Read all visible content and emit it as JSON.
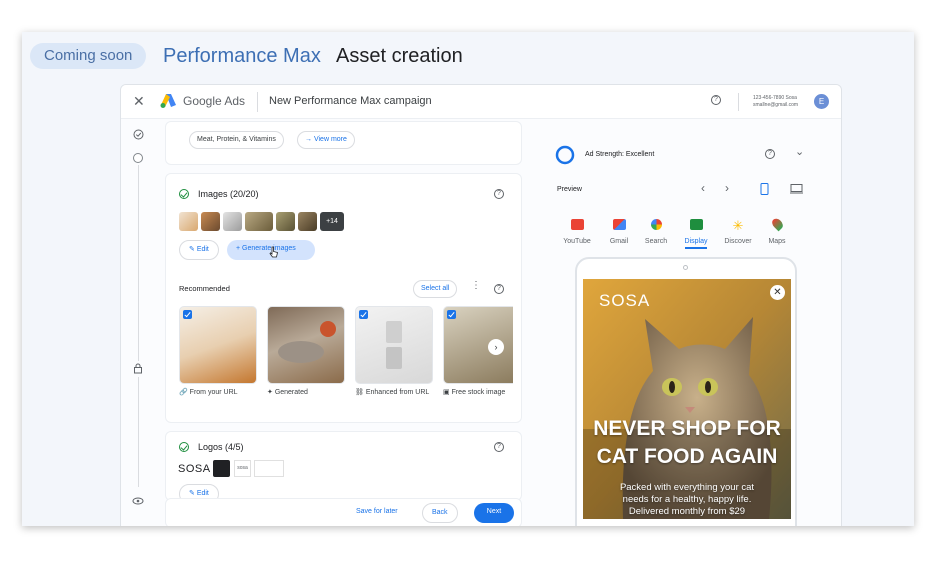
{
  "slide": {
    "badge": "Coming soon",
    "title_product": "Performance Max",
    "title_section": "Asset creation"
  },
  "topbar": {
    "app_name": "Google Ads",
    "campaign_title": "New Performance Max campaign",
    "account_line1": "123-456-7890 Sosa",
    "account_line2": "smallne@gmail.com",
    "avatar_letter": "E"
  },
  "chips": {
    "category": "Meat, Protein, & Vitamins",
    "view_more": "View more"
  },
  "images_section": {
    "title": "Images (20/20)",
    "extra_count": "+14",
    "edit_label": "Edit",
    "generate_label": "Generate images"
  },
  "recommended": {
    "title": "Recommended",
    "select_all": "Select all",
    "items": [
      {
        "label": "From your URL",
        "icon": "link-icon"
      },
      {
        "label": "Generated",
        "icon": "sparkle-icon"
      },
      {
        "label": "Enhanced from URL",
        "icon": "link-sparkle-icon"
      },
      {
        "label": "Free stock image",
        "icon": "image-icon"
      }
    ]
  },
  "logos_section": {
    "title": "Logos (4/5)",
    "logo_text": "SOSA",
    "small_logo_text": "sosa",
    "edit_label": "Edit"
  },
  "bottom": {
    "save_later": "Save for later",
    "back": "Back",
    "next": "Next"
  },
  "preview_panel": {
    "ad_strength": "Ad Strength: Excellent",
    "preview_label": "Preview",
    "tabs": [
      {
        "label": "YouTube",
        "color": "#ea4335"
      },
      {
        "label": "Gmail",
        "color": "#d93025"
      },
      {
        "label": "Search",
        "color": "#4285f4"
      },
      {
        "label": "Display",
        "color": "#1e8e3e"
      },
      {
        "label": "Discover",
        "color": "#fbbc04"
      },
      {
        "label": "Maps",
        "color": "#34a853"
      }
    ],
    "active_tab": "Display"
  },
  "ad": {
    "brand": "SOSA",
    "headline_1": "NEVER SHOP FOR",
    "headline_2": "CAT FOOD AGAIN",
    "body_1": "Packed with everything your cat",
    "body_2": "needs for a healthy, happy life.",
    "body_3": "Delivered monthly from $29"
  },
  "colors": {
    "accent": "#1a73e8",
    "title_blue": "#3d6fb4",
    "badge_bg": "#dbe7f7"
  }
}
